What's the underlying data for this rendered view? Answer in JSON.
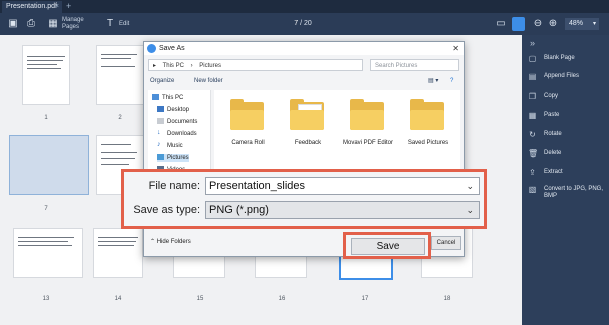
{
  "window": {
    "tab_title": "Presentation.pdf"
  },
  "toolbar": {
    "manage_pages": "Manage Pages",
    "edit": "Edit",
    "page_current": "7",
    "page_sep": "/ 20",
    "zoom": "48%"
  },
  "pages": [
    "1",
    "2",
    "7",
    "13",
    "14",
    "15",
    "16",
    "17",
    "18"
  ],
  "sidebar": {
    "items": [
      "Blank Page",
      "Append Files",
      "Copy",
      "Paste",
      "Rotate",
      "Delete",
      "Extract",
      "Convert to JPG, PNG, BMP"
    ]
  },
  "dialog": {
    "title": "Save As",
    "path": [
      "This PC",
      "Pictures"
    ],
    "search_placeholder": "Search Pictures",
    "organize": "Organize",
    "new_folder": "New folder",
    "tree": [
      "This PC",
      "Desktop",
      "Documents",
      "Downloads",
      "Music",
      "Pictures",
      "Videos"
    ],
    "folders": [
      "Camera Roll",
      "Feedback",
      "Movavi PDF Editor",
      "Saved Pictures"
    ],
    "file_name_label": "File name:",
    "file_name_value": "Presentation_slides",
    "save_type_label": "Save as type:",
    "save_type_value": "PNG (*.png)",
    "hide_folders": "Hide Folders",
    "save": "Save",
    "cancel": "Cancel"
  },
  "colors": {
    "highlight": "#e2604a",
    "accent": "#3d8ee8",
    "sidebar_bg": "#2d3f5b"
  }
}
